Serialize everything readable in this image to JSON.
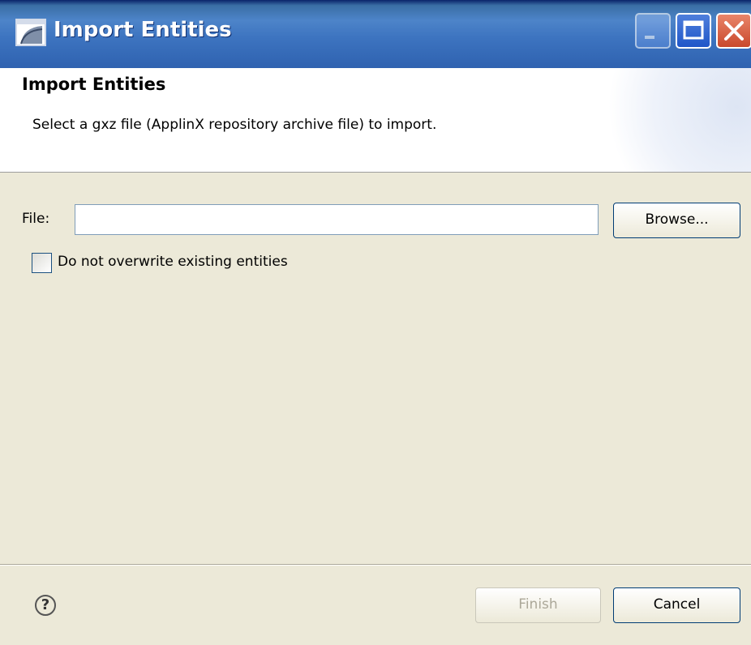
{
  "window": {
    "title": "Import Entities"
  },
  "header": {
    "title": "Import Entities",
    "description": "Select a gxz file (ApplinX repository archive file) to import."
  },
  "form": {
    "file_label": "File:",
    "file_value": "",
    "browse_label": "Browse...",
    "overwrite_label": "Do not overwrite existing entities",
    "overwrite_checked": false
  },
  "footer": {
    "finish_label": "Finish",
    "cancel_label": "Cancel"
  },
  "icons": {
    "app": "eclipse-window-icon",
    "help": "help-icon",
    "minimize": "minimize-icon",
    "maximize": "maximize-icon",
    "close": "close-icon"
  },
  "colors": {
    "titlebar": "#3d74c0",
    "dialog_bg": "#ece9d8",
    "disabled_text": "#aca899"
  }
}
